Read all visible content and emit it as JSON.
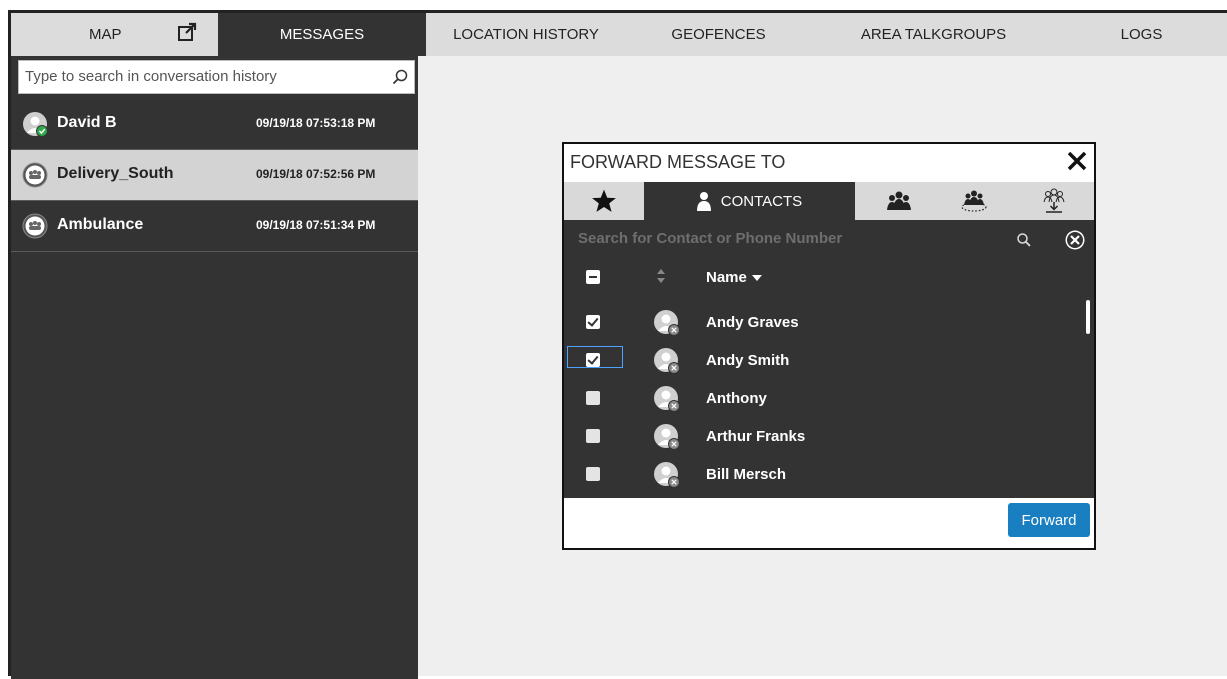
{
  "tabs": {
    "map": "MAP",
    "messages": "MESSAGES",
    "location_history": "LOCATION HISTORY",
    "geofences": "GEOFENCES",
    "area_talkgroups": "AREA TALKGROUPS",
    "logs": "LOGS"
  },
  "conversation_search": {
    "placeholder": "Type to search in conversation history"
  },
  "conversations": [
    {
      "name": "David B",
      "time": "09/19/18 07:53:18 PM",
      "icon": "user-online-icon"
    },
    {
      "name": "Delivery_South",
      "time": "09/19/18 07:52:56 PM",
      "icon": "group-icon"
    },
    {
      "name": "Ambulance",
      "time": "09/19/18 07:51:34 PM",
      "icon": "group-icon"
    }
  ],
  "dialog": {
    "title": "FORWARD MESSAGE TO",
    "tabs": {
      "favorites_icon": "star-icon",
      "contacts": "CONTACTS",
      "groups_icon": "group-icon",
      "area_groups_icon": "area-group-icon",
      "dispatch_groups_icon": "dispatch-group-icon"
    },
    "search_placeholder": "Search for Contact or Phone Number",
    "column_name": "Name",
    "contacts": [
      {
        "name": "Andy Graves",
        "checked": true
      },
      {
        "name": "Andy Smith",
        "checked": true
      },
      {
        "name": "Anthony",
        "checked": false
      },
      {
        "name": "Arthur Franks",
        "checked": false
      },
      {
        "name": "Bill Mersch",
        "checked": false
      }
    ],
    "forward_label": "Forward"
  },
  "colors": {
    "accent": "#1a7fc1",
    "panel": "#333333",
    "online": "#2eaa4a"
  }
}
